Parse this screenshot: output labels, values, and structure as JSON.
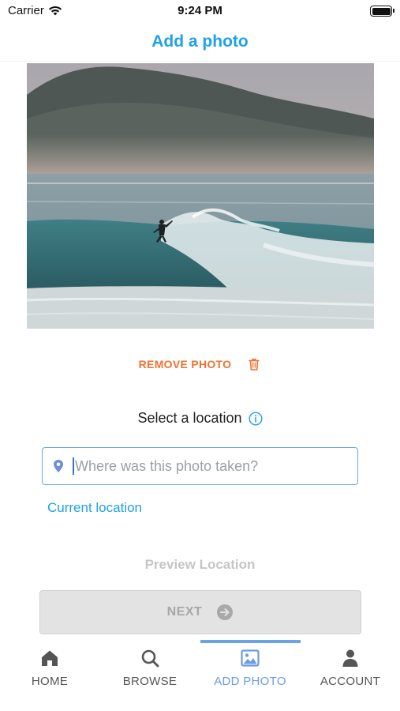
{
  "status_bar": {
    "carrier": "Carrier",
    "time": "9:24 PM"
  },
  "header": {
    "title": "Add a photo"
  },
  "photo": {
    "icon": "surfer-photo"
  },
  "remove_photo": {
    "label": "REMOVE PHOTO",
    "icon": "trash-icon"
  },
  "location": {
    "heading": "Select a location",
    "input_placeholder": "Where was this photo taken?",
    "current_location_label": "Current location",
    "preview_label": "Preview Location"
  },
  "next_button": {
    "label": "NEXT",
    "icon": "arrow-right-circle-icon"
  },
  "tabs": [
    {
      "label": "HOME",
      "icon": "home-icon",
      "active": false
    },
    {
      "label": "BROWSE",
      "icon": "search-icon",
      "active": false
    },
    {
      "label": "ADD PHOTO",
      "icon": "image-icon",
      "active": true
    },
    {
      "label": "ACCOUNT",
      "icon": "person-icon",
      "active": false
    }
  ],
  "colors": {
    "title_blue": "#1ea1e6",
    "remove_orange": "#f2712f",
    "active_tab": "#6b9be5",
    "input_border": "#6aa6e8",
    "disabled_gray": "#a7a7a7"
  }
}
